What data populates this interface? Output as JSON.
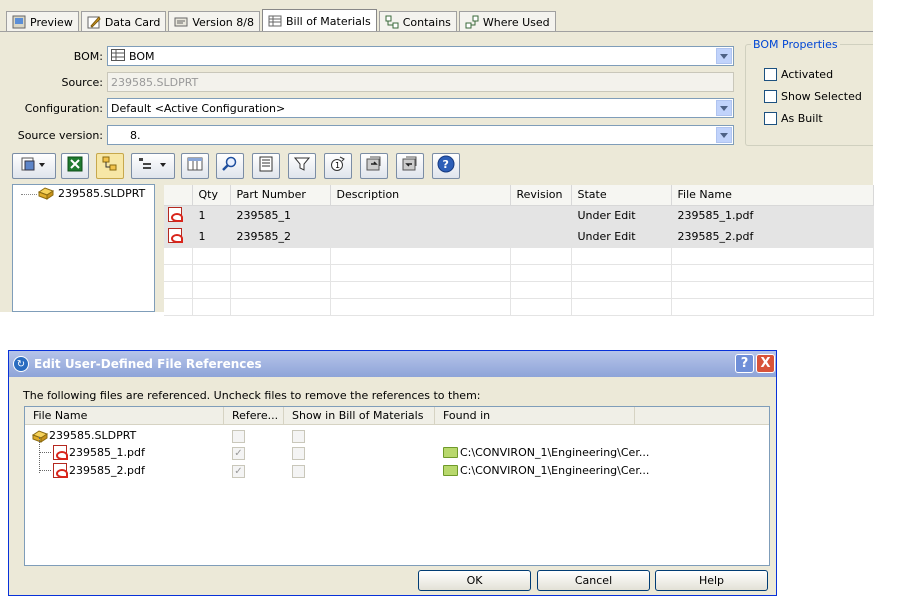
{
  "tabs": [
    {
      "label": "Preview",
      "icon": "preview-icon"
    },
    {
      "label": "Data Card",
      "icon": "data-card-icon"
    },
    {
      "label": "Version 8/8",
      "icon": "version-icon"
    },
    {
      "label": "Bill of Materials",
      "icon": "bom-icon",
      "active": true
    },
    {
      "label": "Contains",
      "icon": "contains-icon"
    },
    {
      "label": "Where Used",
      "icon": "where-used-icon"
    }
  ],
  "form": {
    "bom_label": "BOM:",
    "bom_value": "BOM",
    "source_label": "Source:",
    "source_value": "239585.SLDPRT",
    "config_label": "Configuration:",
    "config_value": "Default <Active Configuration>",
    "version_label": "Source version:",
    "version_value": "8."
  },
  "bom_properties": {
    "title": "BOM Properties",
    "activated": "Activated",
    "show_selected": "Show Selected",
    "as_built": "As Built"
  },
  "tree": {
    "root": "239585.SLDPRT"
  },
  "grid": {
    "headers": [
      "Qty",
      "Part Number",
      "Description",
      "Revision",
      "State",
      "File Name"
    ],
    "rows": [
      {
        "qty": "1",
        "part": "239585_1",
        "desc": "",
        "rev": "",
        "state": "Under Edit",
        "file": "239585_1.pdf"
      },
      {
        "qty": "1",
        "part": "239585_2",
        "desc": "",
        "rev": "",
        "state": "Under Edit",
        "file": "239585_2.pdf"
      }
    ]
  },
  "dialog": {
    "title": "Edit User-Defined File References",
    "help_glyph": "?",
    "close_glyph": "X",
    "instruction": "The following files are referenced. Uncheck files to remove the references to them:",
    "headers": [
      "File Name",
      "Refere...",
      "Show in Bill of Materials",
      "Found in"
    ],
    "rows": [
      {
        "name": "239585.SLDPRT",
        "found": ""
      },
      {
        "name": "239585_1.pdf",
        "found": "C:\\CONVIRON_1\\Engineering\\Cer..."
      },
      {
        "name": "239585_2.pdf",
        "found": "C:\\CONVIRON_1\\Engineering\\Cer..."
      }
    ],
    "ok": "OK",
    "cancel": "Cancel",
    "help": "Help"
  }
}
